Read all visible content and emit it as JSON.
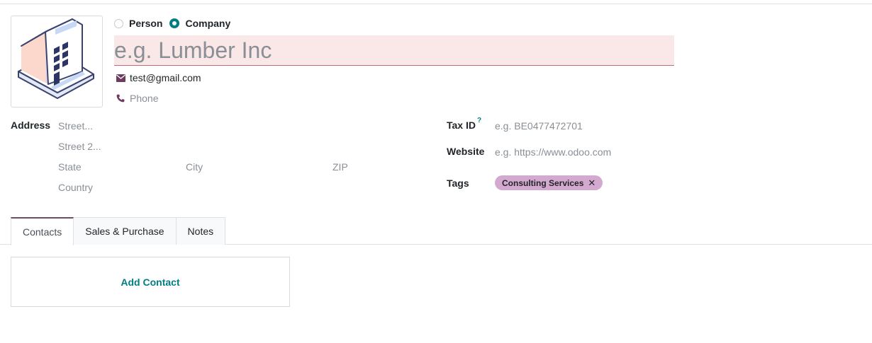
{
  "company_type": {
    "options": [
      {
        "label": "Person",
        "checked": false
      },
      {
        "label": "Company",
        "checked": true
      }
    ]
  },
  "name": {
    "placeholder": "e.g. Lumber Inc",
    "value": ""
  },
  "email": {
    "icon": "envelope-icon",
    "value": "test@gmail.com"
  },
  "phone": {
    "icon": "phone-icon",
    "placeholder": "Phone"
  },
  "address": {
    "label": "Address",
    "street_placeholder": "Street...",
    "street2_placeholder": "Street 2...",
    "state_placeholder": "State",
    "city_placeholder": "City",
    "zip_placeholder": "ZIP",
    "country_placeholder": "Country"
  },
  "tax_id": {
    "label": "Tax ID",
    "help": "?",
    "placeholder": "e.g. BE0477472701"
  },
  "website": {
    "label": "Website",
    "placeholder": "e.g. https://www.odoo.com"
  },
  "tags": {
    "label": "Tags",
    "items": [
      {
        "label": "Consulting Services",
        "remove": "✕"
      }
    ]
  },
  "tabs": [
    {
      "label": "Contacts",
      "active": true
    },
    {
      "label": "Sales & Purchase",
      "active": false
    },
    {
      "label": "Notes",
      "active": false
    }
  ],
  "contacts": {
    "add_label": "Add Contact"
  },
  "colors": {
    "accent": "#017e84",
    "brand": "#714b67",
    "tag": "#d4a9cf",
    "required_bg": "#fae8e9"
  }
}
